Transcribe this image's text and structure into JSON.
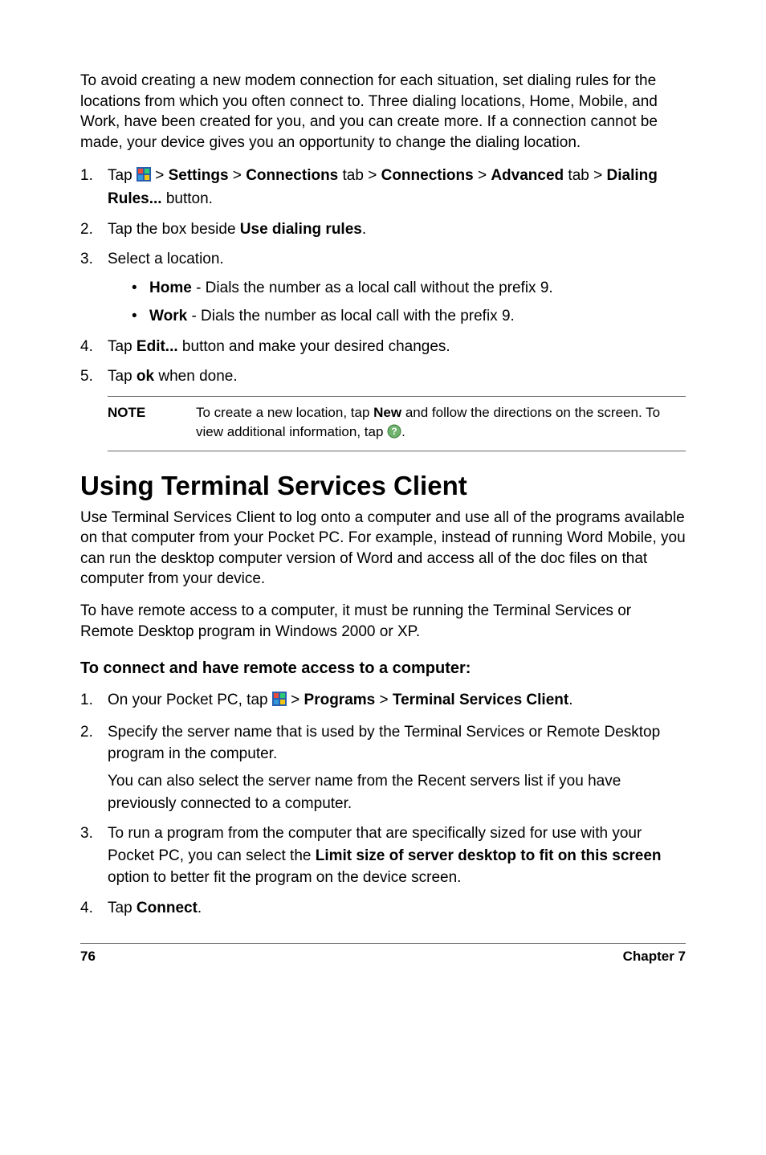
{
  "intro": "To avoid creating a new modem connection for each situation, set dialing rules for the locations from which you often connect to. Three dialing locations, Home, Mobile, and Work, have been created for you, and you can create more. If a connection cannot be made, your device gives you an opportunity to change the dialing location.",
  "steps1": {
    "1": {
      "pre": "Tap ",
      "post_start": " > ",
      "b1": "Settings",
      "sep1": " > ",
      "b2": "Connections",
      "tab_word": " tab > ",
      "b3": "Connections",
      "sep2": " > ",
      "b4": "Advanced",
      "line2": " tab > ",
      "b5": "Dialing Rules...",
      "button_word": " button."
    },
    "2": {
      "pre": "Tap the box beside ",
      "b1": "Use dialing rules",
      "post": "."
    },
    "3": {
      "text": "Select a location."
    },
    "bullets": {
      "home": {
        "b": "Home",
        "text": " - Dials the number as a local call without the prefix 9."
      },
      "work": {
        "b": "Work",
        "text": " - Dials the number as local call with the prefix 9."
      }
    },
    "4": {
      "pre": "Tap ",
      "b1": "Edit...",
      "post": " button and make your desired changes."
    },
    "5": {
      "pre": "Tap ",
      "b1": "ok",
      "post": " when done."
    }
  },
  "note": {
    "label": "NOTE",
    "text1": "To create a new location, tap ",
    "b1": "New",
    "text2": " and follow the directions on the screen. To view additional information, tap ",
    "text3": "."
  },
  "heading": "Using Terminal Services Client",
  "para1": "Use Terminal Services Client to log onto a computer and use all of the programs available on that computer from your Pocket PC. For example, instead of running Word Mobile, you can run the desktop computer version of Word and access all of the doc files on that computer from your device.",
  "para2": "To have remote access to a computer, it must be running the Terminal Services or Remote Desktop program in Windows 2000 or XP.",
  "subheading": "To connect and have remote access to a computer:",
  "steps2": {
    "1": {
      "pre": "On your Pocket PC, tap ",
      "sep1": " > ",
      "b1": "Programs",
      "sep2": " > ",
      "b2": "Terminal Services Client",
      "post": "."
    },
    "2": {
      "text": "Specify the server name that is used by the Terminal Services or Remote Desktop program in the computer.",
      "sub": "You can also select the server name from the Recent servers list if you have previously connected to a computer."
    },
    "3": {
      "pre": "To run a program from the computer that are specifically sized for use with your Pocket PC, you can select the ",
      "b1": "Limit size of server desktop to fit on this screen",
      "post": " option to better fit the program on the device screen."
    },
    "4": {
      "pre": "Tap ",
      "b1": "Connect",
      "post": "."
    }
  },
  "footer": {
    "page": "76",
    "chapter": "Chapter 7"
  },
  "nums": {
    "1": "1.",
    "2": "2.",
    "3": "3.",
    "4": "4.",
    "5": "5."
  }
}
